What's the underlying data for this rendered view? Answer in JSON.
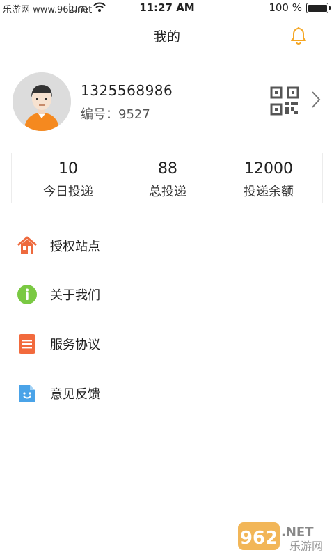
{
  "status_bar": {
    "watermark_url": "乐游网 www.962.net",
    "carrier": "ium",
    "time": "11:27 AM",
    "battery": "100 %"
  },
  "nav": {
    "title": "我的",
    "bell_icon": "bell-icon",
    "bell_color": "#f5a623"
  },
  "profile": {
    "phone": "1325568986",
    "id_text": "编号：9527",
    "qr_icon": "qr-code-icon",
    "chevron_icon": "chevron-right-icon"
  },
  "stats": [
    {
      "value": "10",
      "label": "今日投递"
    },
    {
      "value": "88",
      "label": "总投递"
    },
    {
      "value": "12000",
      "label": "投递余额"
    }
  ],
  "menu": [
    {
      "label": "授权站点",
      "icon": "house-icon",
      "color": "#ee6a3e"
    },
    {
      "label": "关于我们",
      "icon": "info-icon",
      "color": "#7ac943"
    },
    {
      "label": "服务协议",
      "icon": "document-icon",
      "color": "#f26a3d"
    },
    {
      "label": "意见反馈",
      "icon": "feedback-icon",
      "color": "#4aa3e8"
    }
  ],
  "watermark": {
    "number": "962",
    "suffix": ".NET",
    "site_name": "乐游网"
  }
}
